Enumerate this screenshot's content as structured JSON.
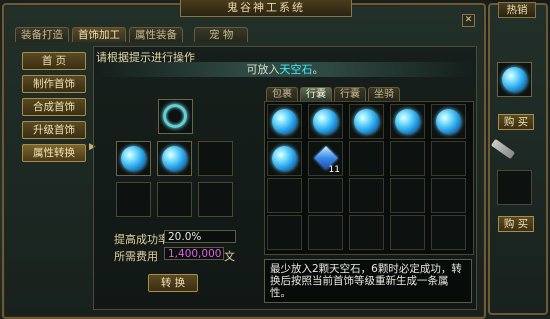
{
  "window": {
    "title": "鬼谷神工系统",
    "close_label": "✕"
  },
  "tabs": [
    "装备打造",
    "首饰加工",
    "属性装备",
    "宠 物"
  ],
  "side_menu": [
    "首 页",
    "制作首饰",
    "合成首饰",
    "升级首饰",
    "属性转换"
  ],
  "prompt": "请根据提示进行操作",
  "info": {
    "prefix": "可放入",
    "highlight": "天空石",
    "suffix": "。"
  },
  "inventory_tabs": [
    "包裹",
    "行囊",
    "行囊",
    "坐骑"
  ],
  "inventory_slots": [
    {
      "item": "sky-stone-icon"
    },
    {
      "item": "sky-stone-icon"
    },
    {
      "item": "sky-stone-icon"
    },
    {
      "item": "sky-stone-icon"
    },
    {
      "item": "sky-stone-icon"
    },
    {
      "item": "sky-stone-icon"
    },
    {
      "item": "blue-diamond-icon",
      "qty": "11"
    }
  ],
  "form": {
    "success_label": "提高成功率",
    "success_value": "20.0%",
    "fee_label": "所需费用",
    "fee_value": "1,400,000",
    "fee_unit": "文",
    "convert_label": "转 换"
  },
  "description": "最少放入2颗天空石，6颗时必定成功，转换后按照当前首饰等级重新生成一条属性。",
  "shop": {
    "title": "热销",
    "buy_label": "购 买"
  },
  "colors": {
    "highlight": "#3df0ff",
    "gold_border": "#a88c48",
    "fee_text": "#e060e0"
  }
}
